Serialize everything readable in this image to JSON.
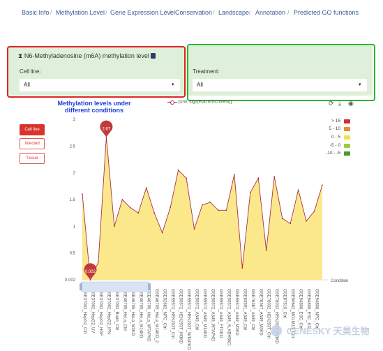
{
  "nav": {
    "items": [
      "Basic Info",
      "Methylation Level",
      "Gene Expression Level",
      "Conservation",
      "Landscape",
      "Annotation",
      "Predicted GO functions"
    ]
  },
  "panel": {
    "title": "N6-Methyladenosine (m6A) methylation level",
    "cell_line_label": "Cell line:",
    "cell_line_value": "All",
    "treatment_label": "Treatment:",
    "treatment_value": "All"
  },
  "side_buttons": [
    "Cell line",
    "Infected",
    "Tissue"
  ],
  "chart_header": {
    "title_line1": "Methylation levels under",
    "title_line2": "different conditions",
    "unit_label": "[Unit: log2(Fold Enrichment)]"
  },
  "legend": [
    {
      "label": "> 15",
      "color": "#d32f2f"
    },
    {
      "label": "5 - 10",
      "color": "#f0892b"
    },
    {
      "label": "0 - 5",
      "color": "#f3e24a"
    },
    {
      "label": "-5 - 0",
      "color": "#9ccc3d"
    },
    {
      "label": "-10 - -5",
      "color": "#4a9a2a"
    }
  ],
  "chart_data": {
    "type": "area",
    "xlabel": "Condition",
    "ylim": [
      0.002,
      3
    ],
    "yticks": [
      "0.002",
      "0.5",
      "1",
      "1.5",
      "2",
      "2.5",
      "3"
    ],
    "max_marker": "2.67",
    "min_marker": "0.002",
    "categories": [
      "GSE37002_HepG2_Ctrl",
      "GSE37002_HepG2_UV",
      "GSE37002_HepG2_HGF",
      "GSE37002_HepG2_IFN",
      "GSE37002_Brain_Ctrl",
      "GSE46705_HeLa_Ctrl",
      "GSE46705_HeLa_M3KD",
      "GSE46705_HeLa_M14KD",
      "GSE46705_HeLa_WTAPKD",
      "GSE46705_HeLa_M14KD_2",
      "GSE52662_NPC_Ctrl",
      "GSE55572_HEK293T_Ctrl",
      "GSE55572_HEK293T_M3KD",
      "GSE55572_HEK293T_WTAPKD",
      "GSE55572_A549_Ctrl",
      "GSE55572_A549_M14KD",
      "GSE55572_A549_WTAPKD",
      "GSE55572_A549_FTOKD",
      "GSE55572_A549_ALKBH5KD",
      "GSE55572_A549_M3KD",
      "GSE63591_A549_Ctrl",
      "GSE76367_A549_Ctrl",
      "GSE76367_A549_M3KD",
      "GSE78032_HEK293T_Ctrl",
      "GSE78032_HEK293T_M3KD",
      "GSE87515_Ctrl",
      "GSE90642_MOLM13_Ctrl",
      "GSE94808_ESC_Ctrl",
      "GSE94808_ESC_KD",
      "GSE94808_NPC_Ctrl"
    ],
    "values": [
      1.6,
      0.002,
      0.33,
      2.67,
      1.0,
      1.5,
      1.35,
      1.25,
      1.72,
      1.25,
      0.88,
      1.35,
      2.05,
      1.9,
      0.95,
      1.4,
      1.45,
      1.3,
      1.3,
      1.97,
      0.22,
      1.63,
      1.9,
      0.55,
      1.93,
      1.15,
      1.05,
      1.68,
      1.1,
      1.28,
      1.77
    ]
  },
  "watermark": "GENESKY 天昊生物"
}
